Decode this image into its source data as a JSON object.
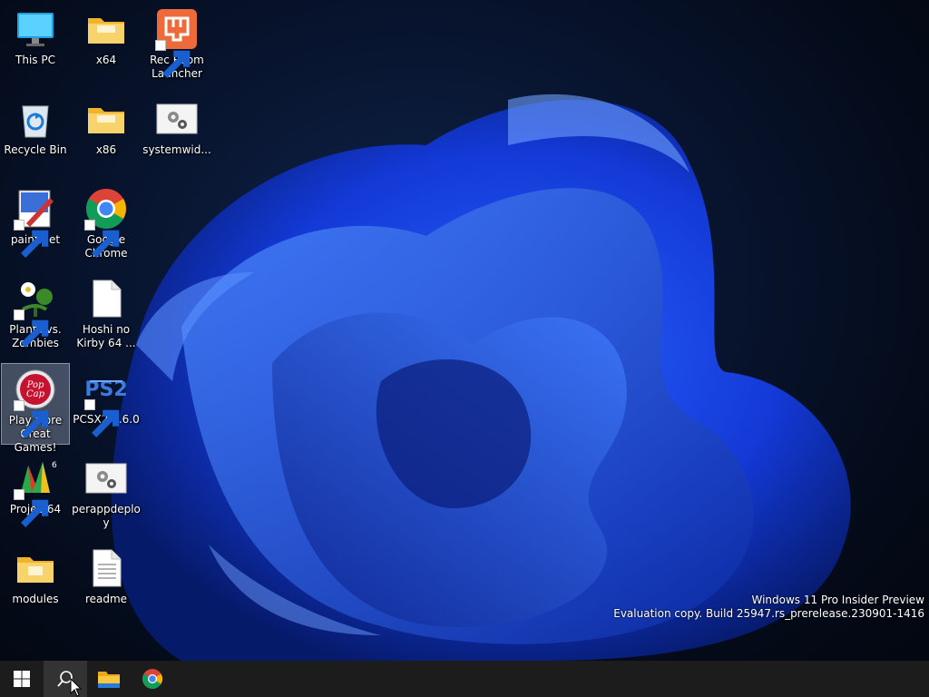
{
  "desktop": {
    "icons": [
      {
        "label": "This PC",
        "icon": "computer-icon"
      },
      {
        "label": "x64",
        "icon": "folder-icon"
      },
      {
        "label": "Rec Room Launcher",
        "icon": "rec-room-icon"
      },
      {
        "label": "Recycle Bin",
        "icon": "recycle-bin-icon"
      },
      {
        "label": "x86",
        "icon": "folder-icon"
      },
      {
        "label": "systemwid...",
        "icon": "settings-file-icon"
      },
      {
        "label": "paint.net",
        "icon": "paint-net-icon"
      },
      {
        "label": "Google Chrome",
        "icon": "chrome-icon"
      },
      {
        "label": "Plants vs. Zombies",
        "icon": "plants-vs-zombies-icon"
      },
      {
        "label": "Hoshi no Kirby 64 ...",
        "icon": "blank-file-icon"
      },
      {
        "label": "Play More Great Games!",
        "icon": "popcap-icon"
      },
      {
        "label": "PCSX2 1.6.0",
        "icon": "pcsx2-icon"
      },
      {
        "label": "Project64",
        "icon": "project64-icon"
      },
      {
        "label": "perappdeploy",
        "icon": "settings-file-icon"
      },
      {
        "label": "modules",
        "icon": "folder-icon"
      },
      {
        "label": "readme",
        "icon": "text-file-icon"
      }
    ]
  },
  "watermark": {
    "line1": "Windows 11 Pro Insider Preview",
    "line2": "Evaluation copy. Build 25947.rs_prerelease.230901-1416"
  },
  "taskbar": {
    "items": [
      {
        "icon": "windows-start-icon"
      },
      {
        "icon": "search-icon"
      },
      {
        "icon": "file-explorer-icon"
      },
      {
        "icon": "chrome-icon"
      }
    ]
  },
  "colors": {
    "wallpaper_bloom": "#1a4dff",
    "taskbar": "#1c1c1c",
    "folder": "#f5c542"
  }
}
